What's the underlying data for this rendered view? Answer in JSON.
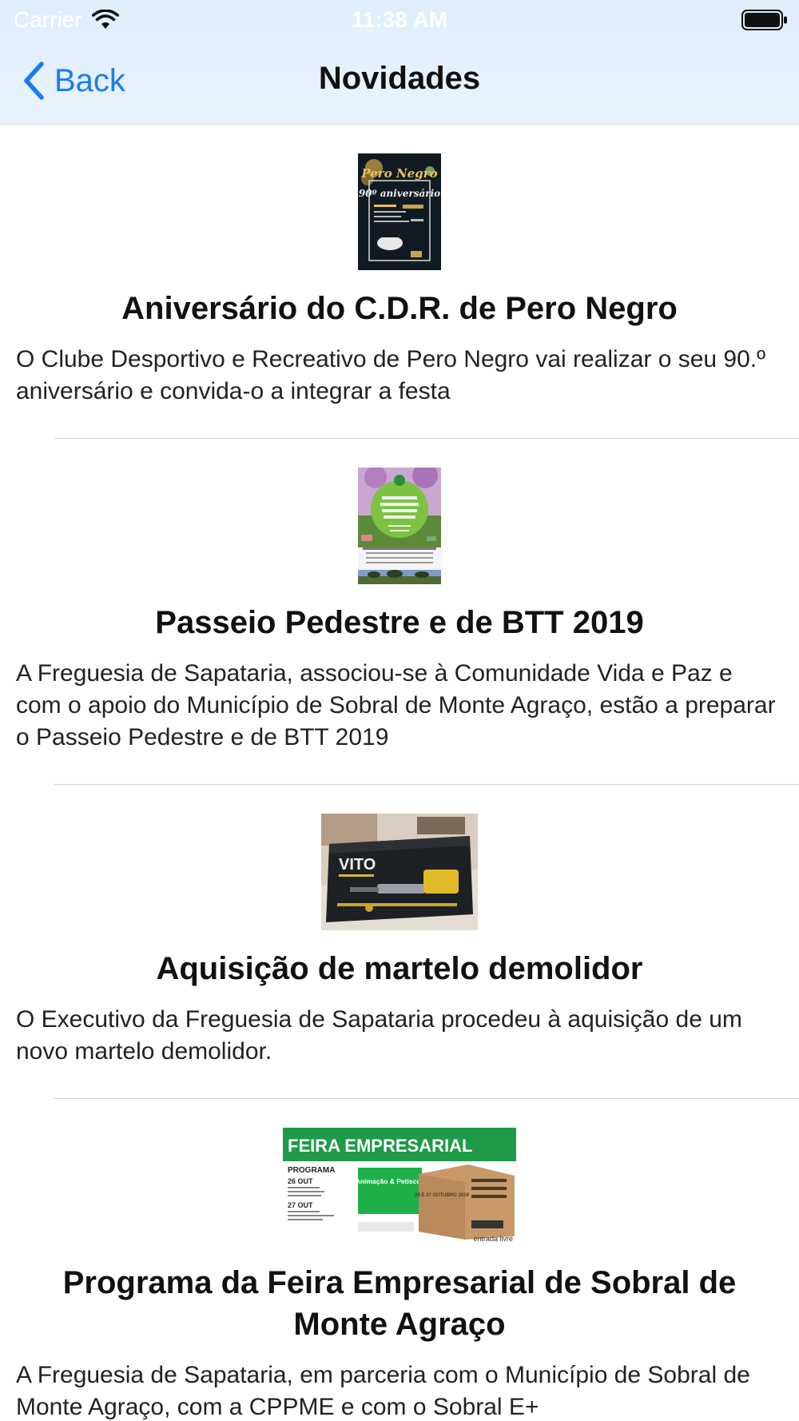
{
  "status_bar": {
    "carrier": "Carrier",
    "time": "11:38 AM"
  },
  "nav_bar": {
    "back_label": "Back",
    "title": "Novidades"
  },
  "colors": {
    "accent": "#1a7cf5",
    "nav_background": "#e3f0fc"
  },
  "news": [
    {
      "title": "Aniversário do C.D.R. de Pero Negro",
      "description": "O Clube Desportivo e Recreativo de Pero Negro vai realizar o seu 90.º aniversário e convida-o a integrar a festa",
      "image_text": [
        "Pero Negro",
        "90º aniversário"
      ]
    },
    {
      "title": "Passeio Pedestre e de BTT 2019",
      "description": "A Freguesia de Sapataria, associou-se à Comunidade Vida e Paz e com o apoio do Município de Sobral de Monte Agraço, estão a preparar o Passeio Pedestre e de BTT 2019",
      "image_text": []
    },
    {
      "title": "Aquisição de martelo demolidor",
      "description": "O Executivo da Freguesia de Sapataria procedeu à aquisição de um novo martelo demolidor.",
      "image_text": [
        "VITO"
      ]
    },
    {
      "title": "Programa da Feira Empresarial de Sobral de Monte Agraço",
      "description": "A Freguesia de Sapataria, em parceria com o Município de Sobral de Monte Agraço, com a CPPME e com o Sobral E+",
      "image_text": [
        "FEIRA EMPRESARIAL",
        "PROGRAMA",
        "26 OUT",
        "27 OUT",
        "Animação & Petiscos",
        "26 E 27 OUTUBRO 2019",
        "entrada livre"
      ]
    }
  ]
}
